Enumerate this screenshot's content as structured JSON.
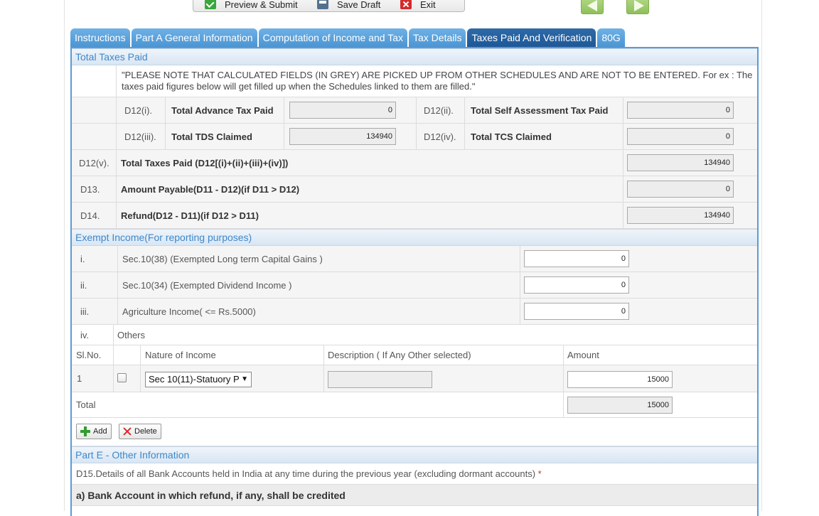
{
  "toolbar": {
    "preview_submit": "Preview & Submit",
    "save_draft": "Save Draft",
    "exit": "Exit"
  },
  "tabs": [
    {
      "label": "Instructions"
    },
    {
      "label": "Part A General Information"
    },
    {
      "label": "Computation of Income and Tax"
    },
    {
      "label": "Tax Details"
    },
    {
      "label": "Taxes Paid And Verification"
    },
    {
      "label": "80G"
    }
  ],
  "taxes_paid": {
    "heading": "Total Taxes Paid",
    "note": "\"PLEASE NOTE THAT CALCULATED FIELDS (IN GREY) ARE PICKED UP FROM OTHER SCHEDULES AND ARE NOT TO BE ENTERED. For ex : The taxes paid figures below will get filled up when the Schedules linked to them are filled.\"",
    "d12i_code": "D12(i).",
    "d12i_label": "Total Advance Tax Paid",
    "d12i_value": "0",
    "d12ii_code": "D12(ii).",
    "d12ii_label": "Total Self Assessment Tax Paid",
    "d12ii_value": "0",
    "d12iii_code": "D12(iii).",
    "d12iii_label": "Total TDS Claimed",
    "d12iii_value": "134940",
    "d12iv_code": "D12(iv).",
    "d12iv_label": "Total TCS Claimed",
    "d12iv_value": "0",
    "d12v_code": "D12(v).",
    "d12v_label": "Total Taxes Paid (D12[(i)+(ii)+(iii)+(iv)])",
    "d12v_value": "134940",
    "d13_code": "D13.",
    "d13_label": "Amount Payable(D11 - D12)(if D11 > D12)",
    "d13_value": "0",
    "d14_code": "D14.",
    "d14_label": "Refund(D12 - D11)(if D12 > D11)",
    "d14_value": "134940"
  },
  "exempt": {
    "heading": "Exempt Income(For reporting purposes)",
    "i_code": "i.",
    "i_label": "Sec.10(38) (Exempted Long term Capital Gains )",
    "i_value": "0",
    "ii_code": "ii.",
    "ii_label": "Sec.10(34) (Exempted Dividend Income )",
    "ii_value": "0",
    "iii_code": "iii.",
    "iii_label": "Agriculture Income( <= Rs.5000)",
    "iii_value": "0",
    "iv_code": "iv.",
    "iv_label": "Others",
    "col_slno": "Sl.No.",
    "col_nature": "Nature of Income",
    "col_desc": "Description ( If Any Other selected)",
    "col_amount": "Amount",
    "row1_slno": "1",
    "row1_nature": "Sec 10(11)-Statuory P",
    "row1_desc": "",
    "row1_amount": "15000",
    "total_label": "Total",
    "total_value": "15000",
    "add_label": "Add",
    "delete_label": "Delete"
  },
  "part_e": {
    "heading": "Part E - Other Information",
    "d15_text": "D15.Details of all Bank Accounts held in India at any time during the previous year (excluding dormant accounts)",
    "required_mark": "*",
    "bank_a": "a) Bank Account in which refund, if any, shall be credited"
  }
}
